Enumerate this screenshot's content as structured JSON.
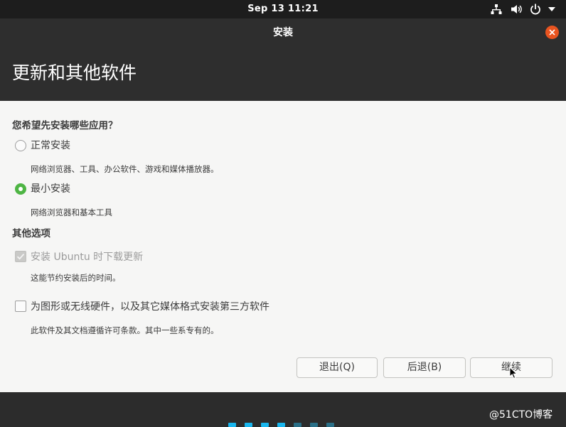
{
  "topbar": {
    "clock": "Sep 13  11:21",
    "icons": [
      "network-icon",
      "volume-icon",
      "power-icon",
      "chevron-down-icon"
    ]
  },
  "window": {
    "title": "安装",
    "close_icon": "close-icon"
  },
  "page": {
    "title": "更新和其他软件"
  },
  "install_type": {
    "heading": "您希望先安装哪些应用？",
    "options": [
      {
        "label": "正常安装",
        "description": "网络浏览器、工具、办公软件、游戏和媒体播放器。",
        "selected": false
      },
      {
        "label": "最小安装",
        "description": "网络浏览器和基本工具",
        "selected": true
      }
    ]
  },
  "other_options": {
    "heading": "其他选项",
    "download_updates": {
      "label": "安装 Ubuntu 时下载更新",
      "description": "这能节约安装后的时间。",
      "checked": true,
      "enabled": false
    },
    "third_party": {
      "label": "为图形或无线硬件，以及其它媒体格式安装第三方软件",
      "description": "此软件及其文档遵循许可条款。其中一些系专有的。",
      "checked": false,
      "enabled": true
    }
  },
  "buttons": {
    "quit": "退出(Q)",
    "back": "后退(B)",
    "continue": "继续"
  },
  "progress": {
    "total_steps": 7,
    "completed_steps": 4,
    "colors": {
      "done": "#19b6ee",
      "pending": "#2a6f87"
    }
  },
  "watermark": "@51CTO博客",
  "colors": {
    "accent_orange": "#e95420",
    "radio_selected": "#4eb544",
    "header_bg": "#2e2e2e",
    "content_bg": "#f6f6f5"
  }
}
